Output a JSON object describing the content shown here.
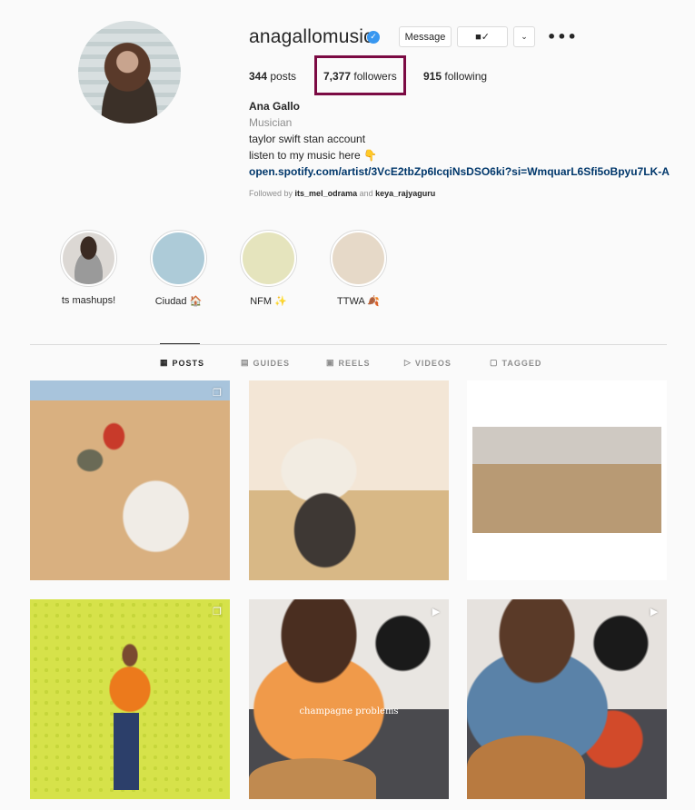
{
  "profile": {
    "username": "anagallomusic",
    "verified_icon": "verified-badge-icon",
    "buttons": {
      "message": "Message",
      "following_icon": "person-check-icon",
      "suggested_icon": "chevron-down-icon",
      "more_icon": "more-options-icon"
    },
    "stats": {
      "posts_count": "344",
      "posts_label": "posts",
      "followers_count": "7,377",
      "followers_label": "followers",
      "following_count": "915",
      "following_label": "following"
    },
    "bio": {
      "name": "Ana Gallo",
      "category": "Musician",
      "line1": "taylor swift stan account",
      "line2": "listen to my music here 👇",
      "link": "open.spotify.com/artist/3VcE2tbZp6IcqiNsDSO6ki?si=WmquarL6Sfi5oBpyu7LK-A",
      "followed_by_prefix": "Followed by",
      "followed_by_user1": "its_mel_odrama",
      "followed_by_and": "and",
      "followed_by_user2": "keya_rajyaguru"
    }
  },
  "highlights": [
    {
      "label": "ts mashups!",
      "color": "#d8d4d0"
    },
    {
      "label": "Ciudad 🏠",
      "color": "#adcbd8"
    },
    {
      "label": "NFM ✨",
      "color": "#e5e4bd"
    },
    {
      "label": "TTWA 🍂",
      "color": "#e6d9c8"
    }
  ],
  "tabs": [
    {
      "label": "POSTS",
      "icon": "▦",
      "active": true
    },
    {
      "label": "GUIDES",
      "icon": "▤",
      "active": false
    },
    {
      "label": "REELS",
      "icon": "▣",
      "active": false
    },
    {
      "label": "VIDEOS",
      "icon": "▷",
      "active": false
    },
    {
      "label": "TAGGED",
      "icon": "▢",
      "active": false
    }
  ],
  "posts": [
    {
      "type": "carousel",
      "badge": "❐"
    },
    {
      "type": "photo",
      "badge": ""
    },
    {
      "type": "photo",
      "badge": ""
    },
    {
      "type": "carousel",
      "badge": "❐"
    },
    {
      "type": "reel",
      "badge": "▶",
      "caption": "champagne problems"
    },
    {
      "type": "reel",
      "badge": "▶"
    }
  ],
  "colors": {
    "highlight_box": "#7b0a43",
    "link": "#00376b",
    "verified": "#3897f0"
  }
}
